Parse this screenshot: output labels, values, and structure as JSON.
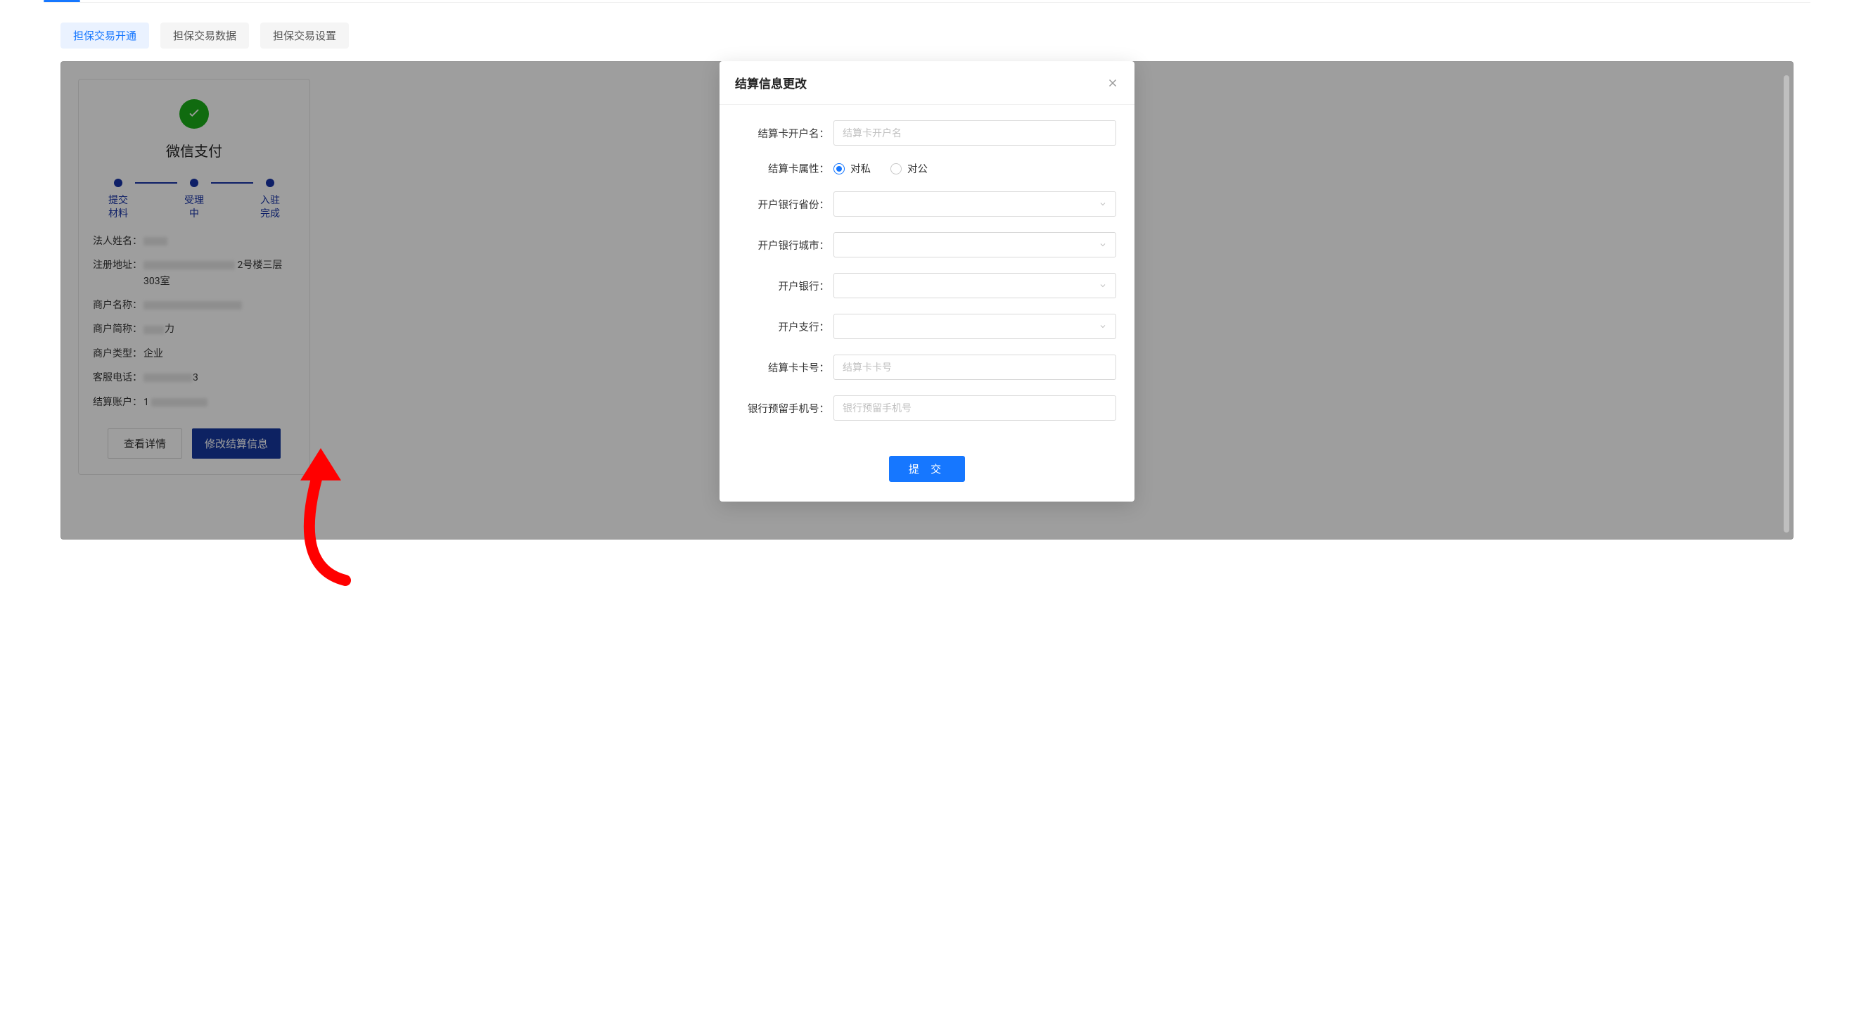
{
  "tabs": {
    "items": [
      {
        "label": "担保交易开通",
        "state": "active"
      },
      {
        "label": "担保交易数据",
        "state": "gray"
      },
      {
        "label": "担保交易设置",
        "state": "gray"
      }
    ]
  },
  "wechat_card": {
    "title": "微信支付",
    "steps": [
      {
        "label": "提交\n材料"
      },
      {
        "label": "受理\n中"
      },
      {
        "label": "入驻\n完成"
      }
    ],
    "info": [
      {
        "label": "法人姓名：",
        "value_full": "[redacted]",
        "value_suffix": ""
      },
      {
        "label": "注册地址：",
        "value_full": "[redacted]",
        "value_suffix": " 2号楼三层303室"
      },
      {
        "label": "商户名称：",
        "value_full": "[redacted]",
        "value_suffix": ""
      },
      {
        "label": "商户简称：",
        "value_full": "[redacted]",
        "value_suffix": "力"
      },
      {
        "label": "商户类型：",
        "value_full": "企业",
        "value_suffix": ""
      },
      {
        "label": "客服电话：",
        "value_full": "[redacted]",
        "value_suffix": "3"
      },
      {
        "label": "结算账户：",
        "value_full": "1 [redacted]",
        "value_suffix": ""
      }
    ],
    "buttons": {
      "detail": "查看详情",
      "modify": "修改结算信息"
    }
  },
  "modal": {
    "title": "结算信息更改",
    "fields": {
      "account_name": {
        "label": "结算卡开户名：",
        "placeholder": "结算卡开户名"
      },
      "card_type": {
        "label": "结算卡属性：",
        "options": [
          {
            "label": "对私",
            "checked": true
          },
          {
            "label": "对公",
            "checked": false
          }
        ]
      },
      "bank_province": {
        "label": "开户银行省份：",
        "placeholder": ""
      },
      "bank_city": {
        "label": "开户银行城市：",
        "placeholder": ""
      },
      "bank": {
        "label": "开户银行：",
        "placeholder": ""
      },
      "branch": {
        "label": "开户支行：",
        "placeholder": ""
      },
      "card_number": {
        "label": "结算卡卡号：",
        "placeholder": "结算卡卡号"
      },
      "reserved_phone": {
        "label": "银行预留手机号：",
        "placeholder": "银行预留手机号"
      }
    },
    "submit_label": "提 交"
  }
}
